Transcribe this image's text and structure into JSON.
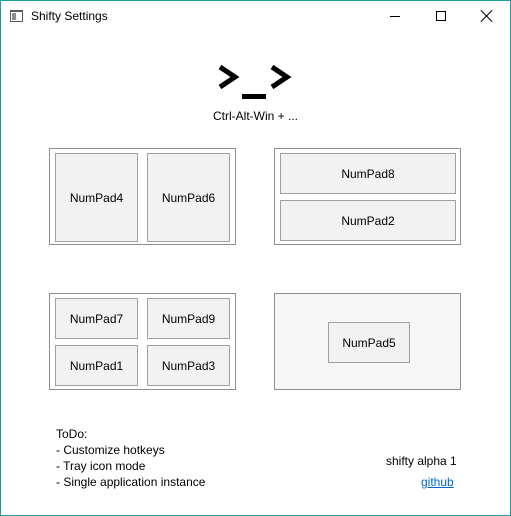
{
  "window": {
    "title": "Shifty Settings",
    "icon": "app-window-icon",
    "accent_border": "#1b9e9a"
  },
  "header": {
    "logo": "shifty-prompt-logo",
    "hotkey_prefix": "Ctrl-Alt-Win + ..."
  },
  "layouts": {
    "left_right": {
      "cells": [
        "NumPad4",
        "NumPad6"
      ]
    },
    "top_bottom": {
      "cells": [
        "NumPad8",
        "NumPad2"
      ]
    },
    "quadrants": {
      "cells": [
        "NumPad7",
        "NumPad9",
        "NumPad1",
        "NumPad3"
      ]
    },
    "center": {
      "cells": [
        "NumPad5"
      ]
    }
  },
  "footer": {
    "todo_title": "ToDo:",
    "todo_items": [
      "- Customize hotkeys",
      "- Tray icon mode",
      "- Single application instance"
    ],
    "version": "shifty alpha 1",
    "link_text": "github",
    "link_color": "#0066cc"
  }
}
